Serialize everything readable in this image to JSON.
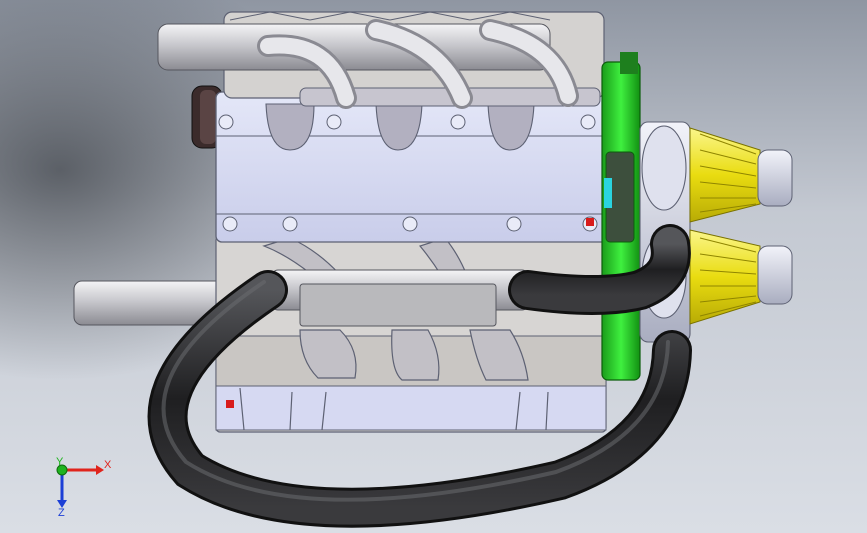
{
  "viewport": {
    "model_name": "",
    "triad": {
      "x_label": "X",
      "y_label": "Y",
      "z_label": "Z",
      "x_color": "#e0241c",
      "y_color": "#1fb31f",
      "z_color": "#1c3fd6"
    }
  },
  "colors": {
    "block": "#d7dcf3",
    "block_edge": "#5d6173",
    "pipe": "#c7c7cc",
    "hose": "#2a2a2c",
    "pulley_green": "#2bd42b",
    "filter_yellow": "#f2ea2a",
    "filter_cap": "#c9ccd9"
  }
}
